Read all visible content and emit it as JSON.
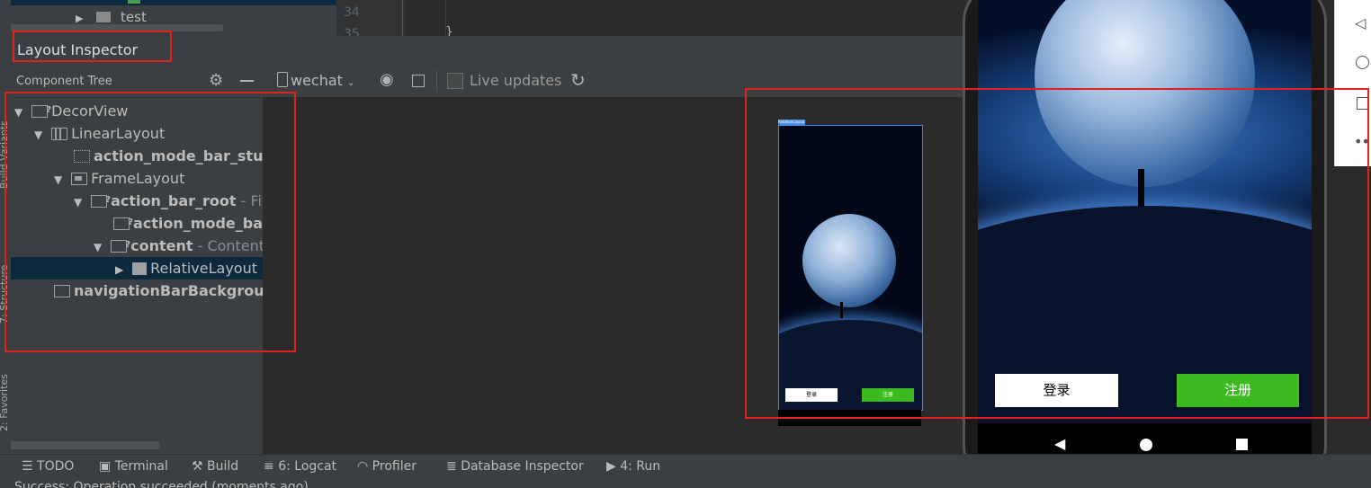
{
  "sidebar_strip": {
    "build_variants_label": "Build Variants",
    "structure_label": "7: Structure",
    "favorites_label": "2: Favorites"
  },
  "project_tree": {
    "top_item": "test"
  },
  "editor": {
    "line_numbers": [
      "34",
      "35"
    ],
    "code_fragment": "}"
  },
  "layout_inspector": {
    "title": "Layout Inspector",
    "component_tree_title": "Component Tree",
    "process": "wechat",
    "live_updates_label": "Live updates",
    "live_updates_checked": false
  },
  "component_tree": [
    {
      "name": "DecorView",
      "suffix": "",
      "bold": false,
      "expanded": true,
      "icon": "view-unknown-icon"
    },
    {
      "name": "LinearLayout",
      "suffix": "",
      "bold": false,
      "expanded": true,
      "icon": "linear-layout-icon"
    },
    {
      "name": "action_mode_bar_stub",
      "suffix": "",
      "bold": true,
      "expanded": null,
      "icon": "view-stub-icon"
    },
    {
      "name": "FrameLayout",
      "suffix": "",
      "bold": false,
      "expanded": true,
      "icon": "frame-layout-icon"
    },
    {
      "name": "action_bar_root",
      "suffix": " - Fit",
      "bold": true,
      "expanded": true,
      "icon": "view-unknown-icon"
    },
    {
      "name": "action_mode_bar_",
      "suffix": "",
      "bold": true,
      "expanded": null,
      "icon": "view-unknown-icon"
    },
    {
      "name": "content",
      "suffix": " - Content",
      "bold": true,
      "expanded": true,
      "icon": "view-unknown-icon"
    },
    {
      "name": "RelativeLayout",
      "suffix": "",
      "bold": false,
      "expanded": false,
      "icon": "relative-layout-icon",
      "selected": true
    },
    {
      "name": "navigationBarBackground",
      "suffix": "",
      "bold": true,
      "expanded": null,
      "icon": "view-icon"
    }
  ],
  "preview": {
    "selection_label": "RelativeLayout",
    "login_label": "登录",
    "register_label": "注册"
  },
  "phone": {
    "login_label": "登录",
    "register_label": "注册"
  },
  "bottom_tabs": [
    {
      "label": "TODO",
      "icon": "list-icon"
    },
    {
      "label": "Terminal",
      "icon": "terminal-icon"
    },
    {
      "label": "Build",
      "icon": "hammer-icon"
    },
    {
      "label": "6: Logcat",
      "icon": "logcat-icon"
    },
    {
      "label": "Profiler",
      "icon": "gauge-icon"
    },
    {
      "label": "Database Inspector",
      "icon": "database-icon"
    },
    {
      "label": "4: Run",
      "icon": "run-icon"
    }
  ],
  "status": {
    "message": "Success: Operation succeeded (moments ago)"
  },
  "colors": {
    "annotation_red": "#e0231e",
    "register_green": "#3bbb1f",
    "selection_bg": "#0d293e"
  }
}
